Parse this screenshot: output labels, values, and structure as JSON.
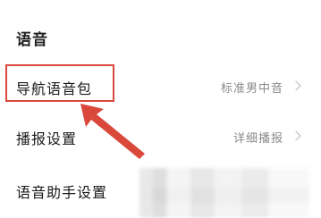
{
  "section": {
    "title": "语音"
  },
  "rows": [
    {
      "label": "导航语音包",
      "value": "标准男中音"
    },
    {
      "label": "播报设置",
      "value": "详细播报"
    },
    {
      "label": "语音助手设置",
      "value": ""
    }
  ],
  "annotation": {
    "color": "#d9483b"
  }
}
